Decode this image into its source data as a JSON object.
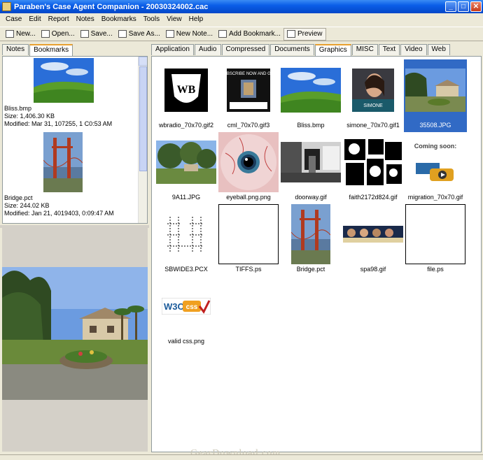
{
  "window": {
    "title": "Paraben's Case Agent Companion - 20030324002.cac",
    "minimize": "_",
    "maximize": "□",
    "close": "✕"
  },
  "menu": [
    "Case",
    "Edit",
    "Report",
    "Notes",
    "Bookmarks",
    "Tools",
    "View",
    "Help"
  ],
  "toolbar": [
    {
      "label": "New...",
      "icon": "new-doc-icon"
    },
    {
      "label": "Open...",
      "icon": "open-folder-icon"
    },
    {
      "label": "Save...",
      "icon": "save-disk-icon"
    },
    {
      "label": "Save As...",
      "icon": "save-as-disk-icon"
    },
    {
      "label": "New Note...",
      "icon": "note-icon"
    },
    {
      "label": "Add Bookmark...",
      "icon": "bookmark-icon"
    },
    {
      "label": "Preview",
      "icon": "preview-icon",
      "active": true
    }
  ],
  "left_tabs": [
    {
      "label": "Notes"
    },
    {
      "label": "Bookmarks",
      "selected": true
    }
  ],
  "bookmarks": [
    {
      "name": "Bliss.bmp",
      "size": "Size: 1,406.30 KB",
      "modified": "Modified: Mar 31, 107255, 1 C0:53 AM",
      "image": "bliss"
    },
    {
      "name": "Bridge.pct",
      "size": "Size: 244.02 KB",
      "modified": "Modified: Jan 21, 4019403, 0:09:47 AM",
      "image": "bridge"
    }
  ],
  "right_tabs": [
    {
      "label": "Application"
    },
    {
      "label": "Audio"
    },
    {
      "label": "Compressed"
    },
    {
      "label": "Documents"
    },
    {
      "label": "Graphics",
      "selected": true
    },
    {
      "label": "MISC"
    },
    {
      "label": "Text"
    },
    {
      "label": "Video"
    },
    {
      "label": "Web"
    }
  ],
  "files": [
    {
      "name": "wbradio_70x70.gif2",
      "image": "wb"
    },
    {
      "name": "cml_70x70.gif3",
      "image": "cml"
    },
    {
      "name": "Bliss.bmp",
      "image": "bliss"
    },
    {
      "name": "simone_70x70.gif1",
      "image": "simone"
    },
    {
      "name": "35508.JPG",
      "image": "house",
      "selected": true
    },
    {
      "name": "9A11.JPG",
      "image": "trees"
    },
    {
      "name": "eyeball.png.png",
      "image": "eye"
    },
    {
      "name": "doorway.gif",
      "image": "doorway"
    },
    {
      "name": "faith2172d824.gif",
      "image": "faith"
    },
    {
      "name": "migration_70x70.gif",
      "image": "coming"
    },
    {
      "name": "SBWIDE3.PCX",
      "image": "sbwide"
    },
    {
      "name": "TIFFS.ps",
      "image": "blank"
    },
    {
      "name": "Bridge.pct",
      "image": "bridge"
    },
    {
      "name": "spa98.gif",
      "image": "band"
    },
    {
      "name": "file.ps",
      "image": "blank"
    },
    {
      "name": "valid css.png",
      "image": "w3c"
    }
  ],
  "image_text": {
    "coming": "Coming soon:",
    "cml": "SUBSCRIBE NOW AND GET",
    "w3c_a": "W3C",
    "w3c_b": "css",
    "simone": "SIMONE"
  },
  "watermark": "GearDownload.com"
}
